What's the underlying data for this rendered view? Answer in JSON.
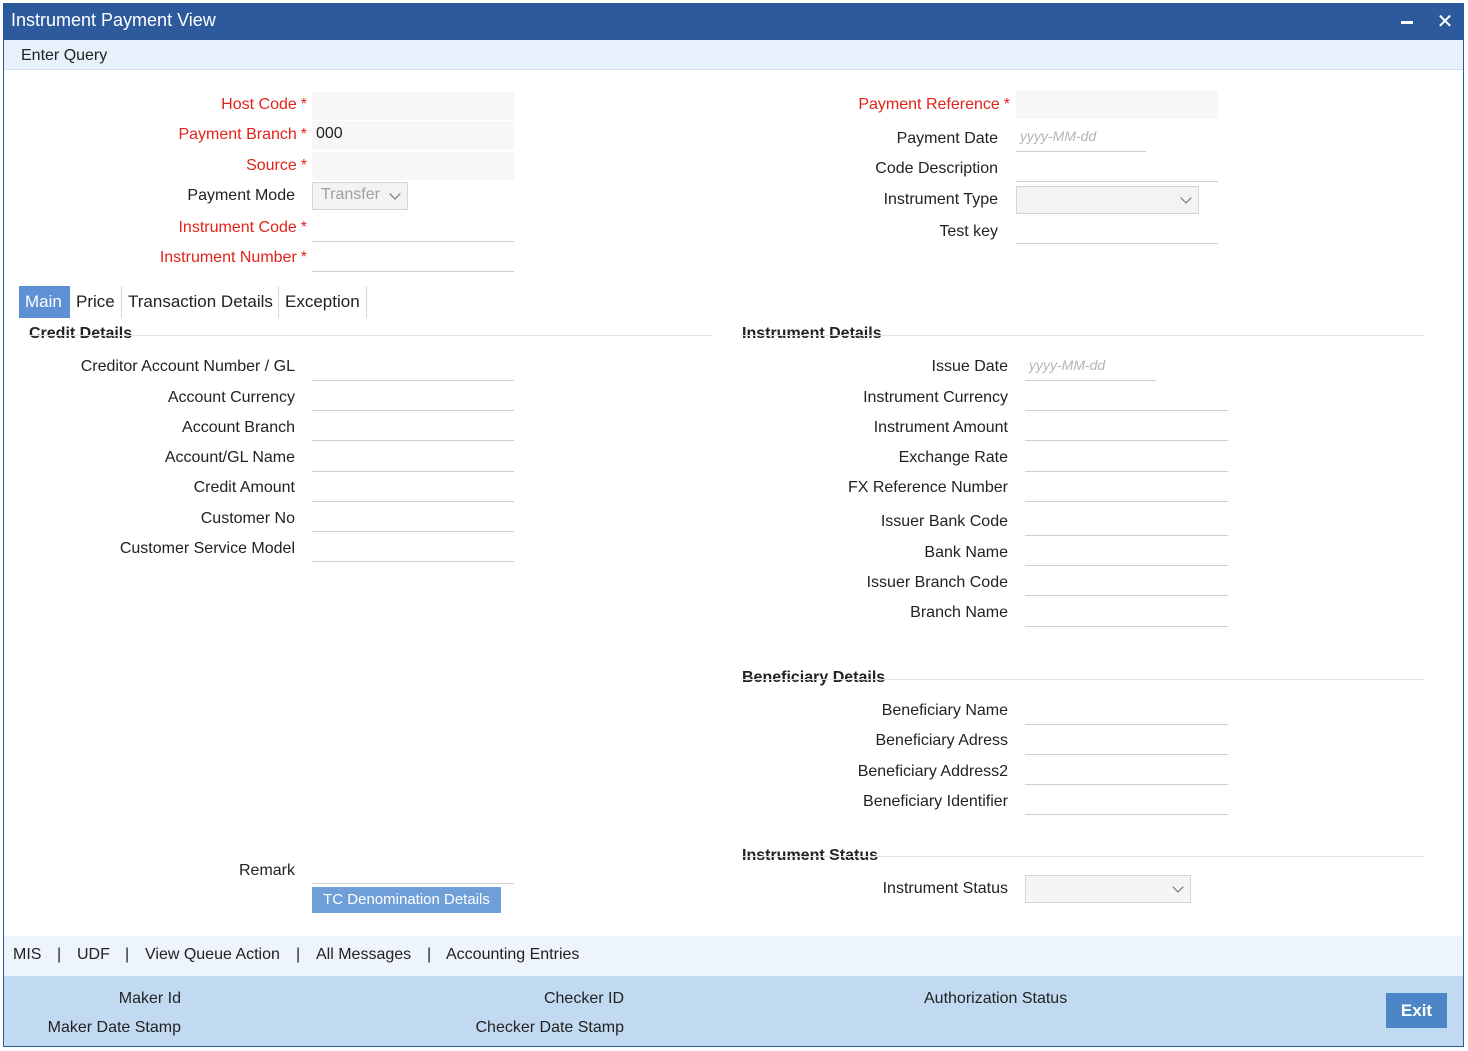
{
  "window": {
    "title": "Instrument Payment View",
    "close_glyph": "✕"
  },
  "menu": {
    "enter_query": "Enter Query"
  },
  "header": {
    "host_code": {
      "label": "Host Code",
      "value": ""
    },
    "payment_branch": {
      "label": "Payment Branch",
      "value": "000"
    },
    "source": {
      "label": "Source",
      "value": ""
    },
    "payment_mode": {
      "label": "Payment Mode",
      "value": "Transfer"
    },
    "instrument_code": {
      "label": "Instrument Code",
      "value": ""
    },
    "instrument_number": {
      "label": "Instrument Number",
      "value": ""
    },
    "payment_reference": {
      "label": "Payment Reference",
      "value": ""
    },
    "payment_date": {
      "label": "Payment Date",
      "placeholder": "yyyy-MM-dd"
    },
    "code_description": {
      "label": "Code Description",
      "value": ""
    },
    "instrument_type": {
      "label": "Instrument Type",
      "value": ""
    },
    "test_key": {
      "label": "Test key",
      "value": ""
    },
    "required_mark": "*"
  },
  "tabs": [
    {
      "label": "Main",
      "active": true
    },
    {
      "label": "Price",
      "active": false
    },
    {
      "label": "Transaction Details",
      "active": false
    },
    {
      "label": "Exception",
      "active": false
    }
  ],
  "credit_details": {
    "title": "Credit Details",
    "fields": [
      "Creditor Account Number / GL",
      "Account Currency",
      "Account Branch",
      "Account/GL Name",
      "Credit Amount",
      "Customer No",
      "Customer Service Model"
    ]
  },
  "instrument_details": {
    "title": "Instrument Details",
    "issue_date": {
      "label": "Issue Date",
      "placeholder": "yyyy-MM-dd"
    },
    "fields": [
      "Instrument Currency",
      "Instrument Amount",
      "Exchange Rate",
      "FX Reference Number",
      "Issuer Bank Code",
      "Bank Name",
      "Issuer Branch Code",
      "Branch Name"
    ]
  },
  "beneficiary_details": {
    "title": "Beneficiary Details",
    "fields": [
      "Beneficiary Name",
      "Beneficiary Adress",
      "Beneficiary Address2",
      "Beneficiary Identifier"
    ]
  },
  "instrument_status": {
    "title": "Instrument Status",
    "label": "Instrument Status",
    "value": ""
  },
  "remark": {
    "label": "Remark",
    "value": ""
  },
  "tc_button": "TC Denomination Details",
  "footer_links": [
    "MIS",
    "UDF",
    "View Queue Action",
    "All Messages",
    "Accounting Entries"
  ],
  "footer_separator": "|",
  "status": {
    "maker_id": "Maker Id",
    "maker_date_stamp": "Maker Date Stamp",
    "checker_id": "Checker ID",
    "checker_date_stamp": "Checker Date Stamp",
    "authorization_status": "Authorization Status",
    "exit": "Exit"
  },
  "colors": {
    "titlebar": "#2d5a9c",
    "required": "#e32219",
    "tab_active": "#5d91d3",
    "statusbar": "#c2daf1",
    "exit_button": "#4c86c6"
  }
}
